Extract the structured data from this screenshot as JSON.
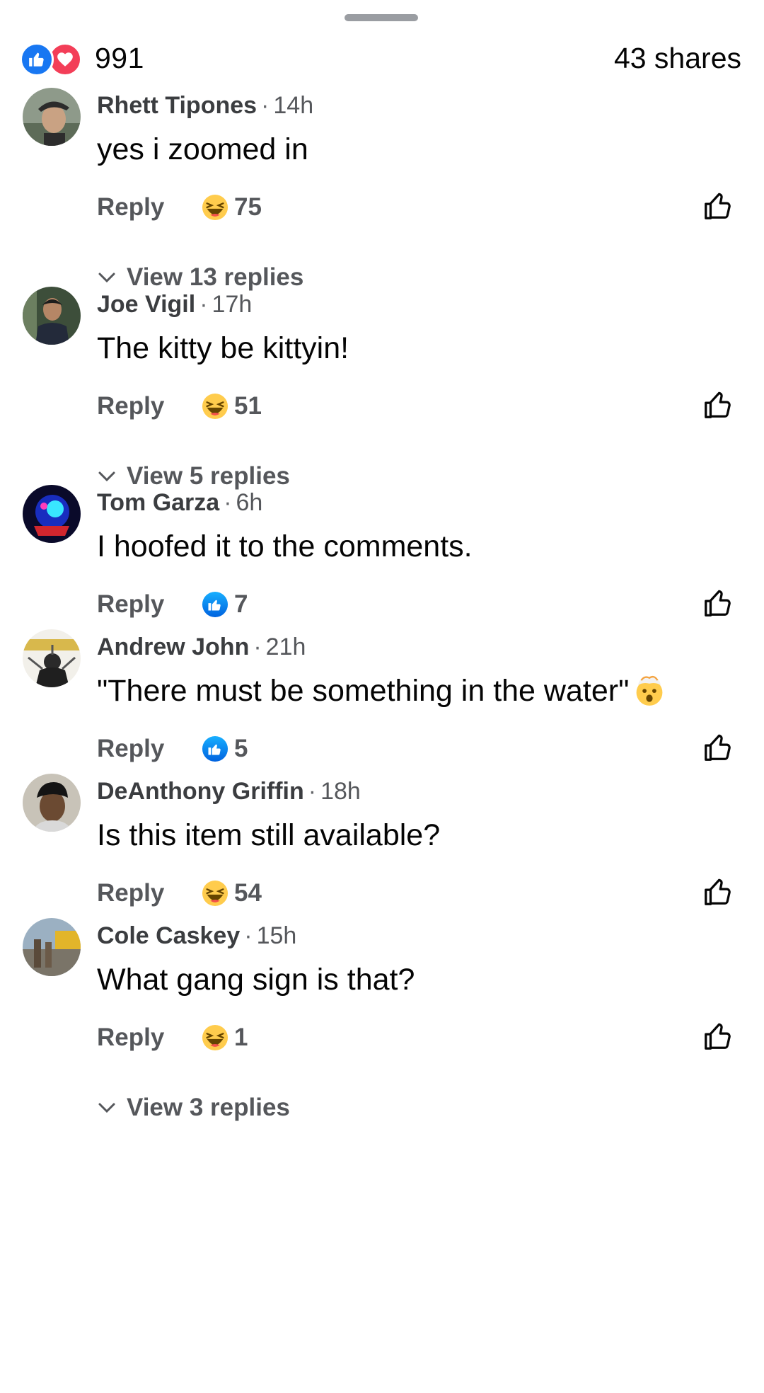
{
  "header": {
    "total_reactions": "991",
    "shares": "43 shares"
  },
  "colors": {
    "like_blue": "#1877f2",
    "love_red": "#f33e58",
    "meta_gray": "#65676b",
    "emoji_yellow": "#ffcc4d"
  },
  "comments": [
    {
      "author": "Rhett Tipones",
      "time": "14h",
      "text": "yes i zoomed in",
      "text_emoji": "",
      "reply_label": "Reply",
      "reaction_icon": "haha-icon",
      "reaction_count": "75",
      "view_replies": "View 13 replies"
    },
    {
      "author": "Joe Vigil",
      "time": "17h",
      "text": "The kitty be kittyin!",
      "text_emoji": "",
      "reply_label": "Reply",
      "reaction_icon": "haha-icon",
      "reaction_count": "51",
      "view_replies": "View 5 replies"
    },
    {
      "author": "Tom Garza",
      "time": "6h",
      "text": "I hoofed it to the comments.",
      "text_emoji": "",
      "reply_label": "Reply",
      "reaction_icon": "like-icon",
      "reaction_count": "7",
      "view_replies": ""
    },
    {
      "author": "Andrew John",
      "time": "21h",
      "text": "\"There must be something in the water\"",
      "text_emoji": "exploding-head-emoji",
      "reply_label": "Reply",
      "reaction_icon": "like-icon",
      "reaction_count": "5",
      "view_replies": ""
    },
    {
      "author": "DeAnthony Griffin",
      "time": "18h",
      "text": "Is this item still available?",
      "text_emoji": "",
      "reply_label": "Reply",
      "reaction_icon": "haha-icon",
      "reaction_count": "54",
      "view_replies": ""
    },
    {
      "author": "Cole Caskey",
      "time": "15h",
      "text": "What gang sign is that?",
      "text_emoji": "",
      "reply_label": "Reply",
      "reaction_icon": "haha-icon",
      "reaction_count": "1",
      "view_replies": "View 3 replies"
    }
  ]
}
